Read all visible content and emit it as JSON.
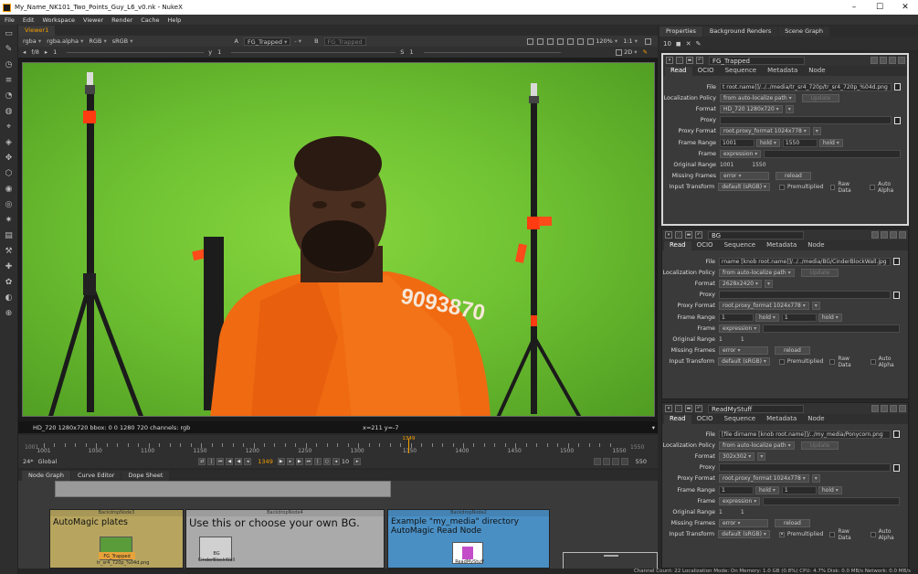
{
  "window": {
    "title": "My_Name_NK101_Two_Points_Guy_L6_v0.nk - NukeX",
    "minimize": "–",
    "maximize": "☐",
    "close": "✕"
  },
  "menu": [
    "File",
    "Edit",
    "Workspace",
    "Viewer",
    "Render",
    "Cache",
    "Help"
  ],
  "viewer": {
    "tab": "Viewer1",
    "channels": "rgba",
    "alpha": "rgba.alpha",
    "colorspace": "RGB",
    "display": "sRGB",
    "input_a": "FG_Trapped",
    "input_b": "FG_Trapped",
    "sep": "-",
    "a_label": "A",
    "b_label": "B",
    "fstop_label": "f/8",
    "gain": "1",
    "y_label": "y",
    "y_value": "1",
    "s_label": "S",
    "s_value": "1",
    "zoom": "120%",
    "ratio": "1:1",
    "view_mode": "2D",
    "info_left": "HD_720 1280x720  bbox: 0 0 1280 720 channels: rgb",
    "info_coord": "x=211 y=-7",
    "jersey_text": "9093870"
  },
  "timeline": {
    "start": "1001",
    "end": "1550",
    "labels": [
      "1001",
      "1050",
      "1100",
      "1150",
      "1200",
      "1250",
      "1300",
      "1350",
      "1400",
      "1450",
      "1500",
      "1550"
    ],
    "current": "1349",
    "fps": "24*",
    "mode": "Global",
    "step": "10",
    "end_box": "550"
  },
  "node_graph": {
    "tabs": [
      "Node Graph",
      "Curve Editor",
      "Dope Sheet"
    ],
    "backdrops": [
      {
        "title": "BackdropNode3",
        "label": "AutoMagic plates",
        "color": "#b7a55f"
      },
      {
        "title": "BackdropNode4",
        "label": "Use this or choose your own BG.",
        "color": "#aaaaaa"
      },
      {
        "title": "BackdropNode2",
        "label": "Example \"my_media\" directory AutoMagic Read Node",
        "color": "#4a8fc4"
      }
    ],
    "nodes": [
      {
        "name": "FG_Trapped",
        "sub": "tr_sr4_720p_%04d.png"
      },
      {
        "name": "BG",
        "sub": "CinderBlockWall"
      },
      {
        "name": "ReadMyStuff",
        "sub": ""
      }
    ]
  },
  "status_bar": "Channel Count: 22  Localization Mode: On  Memory: 1.0 GB (0.8%)  CPU: 4.7%  Disk: 0.0 MB/s  Network: 0.0 MB/s",
  "properties": {
    "tabs": [
      "Properties",
      "Background Renders",
      "Scene Graph"
    ],
    "max_panels": "10",
    "subtabs": [
      "Read",
      "OCIO",
      "Sequence",
      "Metadata",
      "Node"
    ],
    "labels": {
      "file": "File",
      "localization": "Localization Policy",
      "format": "Format",
      "proxy": "Proxy",
      "proxy_format": "Proxy Format",
      "frame_range": "Frame Range",
      "frame": "Frame",
      "original_range": "Original Range",
      "missing_frames": "Missing Frames",
      "input_transform": "Input Transform",
      "premultiplied": "Premultiplied",
      "raw_data": "Raw Data",
      "auto_alpha": "Auto Alpha",
      "update": "Update",
      "reload": "reload"
    },
    "panels": [
      {
        "name": "FG_Trapped",
        "file": "t root.name]]/../../media/tr_sr4_720p/tr_sr4_720p_%04d.png",
        "localization": "from auto-localize path",
        "format": "HD_720 1280x720",
        "proxy_format": "root.proxy_format 1024x778",
        "first": "1001",
        "before": "hold",
        "last": "1550",
        "after": "hold",
        "frame": "expression",
        "orig_first": "1001",
        "orig_last": "1550",
        "missing": "error",
        "transform": "default (sRGB)",
        "premult_checked": false
      },
      {
        "name": "BG",
        "file": "rname [knob root.name]]/../../media/BG/CinderBlockWall.jpg",
        "localization": "from auto-localize path",
        "format": "2628x2420",
        "proxy_format": "root.proxy_format 1024x778",
        "first": "1",
        "before": "hold",
        "last": "1",
        "after": "hold",
        "frame": "expression",
        "orig_first": "1",
        "orig_last": "1",
        "missing": "error",
        "transform": "default (sRGB)",
        "premult_checked": false
      },
      {
        "name": "ReadMyStuff",
        "file": "[file dirname [knob root.name]]/../my_media/Ponycorn.png",
        "localization": "from auto-localize path",
        "format": "302x302",
        "proxy_format": "root.proxy_format 1024x778",
        "first": "1",
        "before": "hold",
        "last": "1",
        "after": "hold",
        "frame": "expression",
        "orig_first": "1",
        "orig_last": "1",
        "missing": "error",
        "transform": "default (sRGB)",
        "premult_checked": true
      }
    ]
  }
}
